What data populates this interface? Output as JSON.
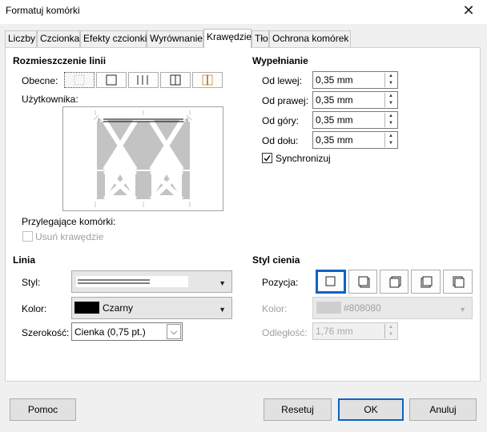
{
  "window": {
    "title": "Formatuj komórki"
  },
  "tabs": [
    "Liczby",
    "Czcionka",
    "Efekty czcionki",
    "Wyrównanie",
    "Krawędzie",
    "Tło",
    "Ochrona komórek"
  ],
  "line_arrangement": {
    "heading": "Rozmieszczenie linii",
    "current_label": "Obecne:",
    "user_label": "Użytkownika:",
    "adjacent_label": "Przylegające komórki:",
    "remove_borders_label": "Usuń krawędzie"
  },
  "padding": {
    "heading": "Wypełnianie",
    "left_label": "Od lewej:",
    "left_value": "0,35 mm",
    "right_label": "Od prawej:",
    "right_value": "0,35 mm",
    "top_label": "Od góry:",
    "top_value": "0,35 mm",
    "bottom_label": "Od dołu:",
    "bottom_value": "0,35 mm",
    "sync_label": "Synchronizuj",
    "sync_checked": true
  },
  "line": {
    "heading": "Linia",
    "style_label": "Styl:",
    "color_label": "Kolor:",
    "color_value": "Czarny",
    "color_hex": "#000000",
    "width_label": "Szerokość:",
    "width_value": "Cienka (0,75 pt.)"
  },
  "shadow": {
    "heading": "Styl cienia",
    "position_label": "Pozycja:",
    "color_label": "Kolor:",
    "color_value": "#808080",
    "distance_label": "Odległość:",
    "distance_value": "1,76 mm"
  },
  "buttons": {
    "help": "Pomoc",
    "reset": "Resetuj",
    "ok": "OK",
    "cancel": "Anuluj"
  },
  "colors": {
    "accent": "#0a64c6",
    "shadow_gray": "#808080"
  }
}
